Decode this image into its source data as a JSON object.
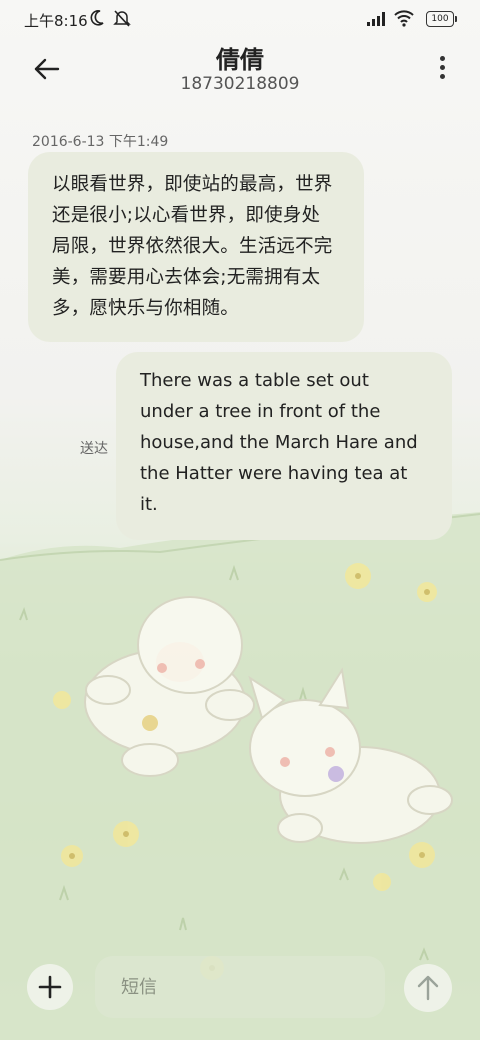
{
  "status_bar": {
    "time": "上午8:16",
    "battery": "100",
    "icons": [
      "moon-icon",
      "mute-icon",
      "signal-icon",
      "wifi-icon",
      "battery-icon"
    ]
  },
  "header": {
    "contact_name": "倩倩",
    "phone_number": "18730218809",
    "back_icon": "back-arrow-icon",
    "more_icon": "more-vertical-icon"
  },
  "conversation": {
    "timestamp": "2016-6-13 下午1:49",
    "received_message": {
      "lines": [
        "以眼看世界，即使站的最高，世界",
        "还是很小;以心看世界，即使身处",
        "局限，世界依然很大。生活远不完",
        "美，需要用心去体会;无需拥有太",
        "多，愿快乐与你相随。"
      ]
    },
    "sent_message": {
      "lines": [
        "There was a table set out",
        "under a tree in front of the",
        "house,and the March Hare and",
        "the Hatter were having tea at",
        "it."
      ],
      "status": "送达"
    }
  },
  "composer": {
    "placeholder": "短信",
    "add_icon": "plus-icon",
    "send_icon": "send-arrow-icon"
  },
  "colors": {
    "bubble": "#e9ecdf",
    "text": "#222222",
    "secondary_text": "#666666",
    "wallpaper_grass": "#d2e1c3"
  }
}
